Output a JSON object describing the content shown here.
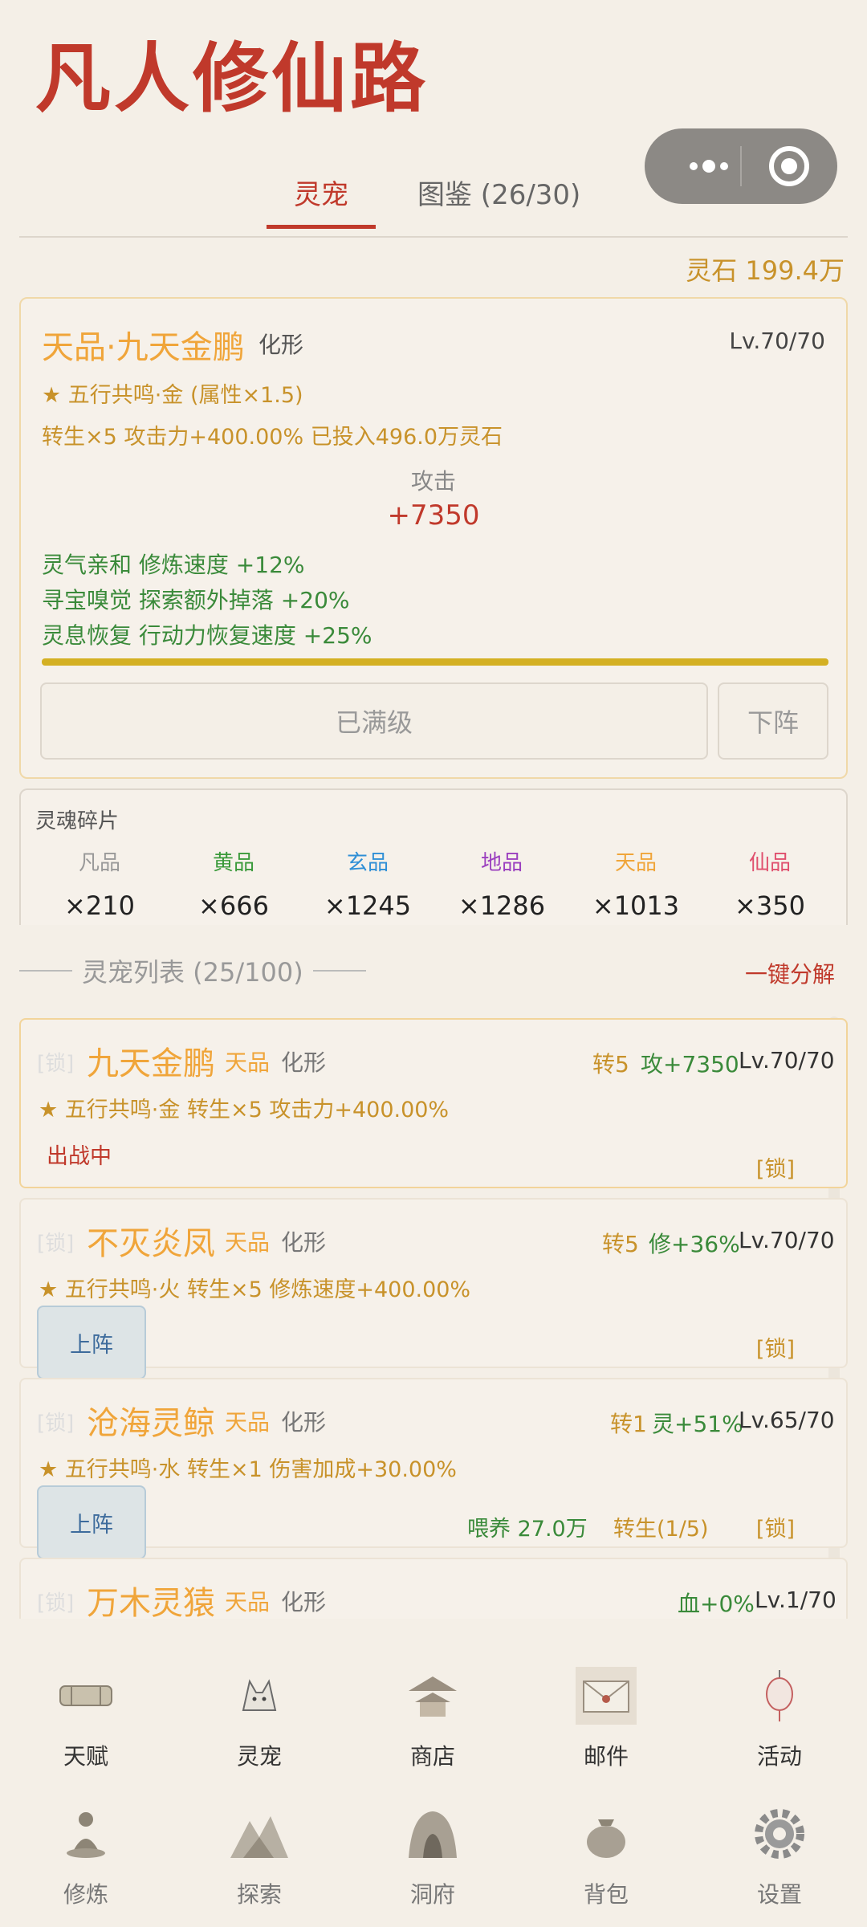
{
  "header": {
    "title": "凡人修仙路"
  },
  "tabs": [
    {
      "label": "灵宠"
    },
    {
      "label": "图鉴 (26/30)"
    }
  ],
  "spirit_stones": "灵石 199.4万",
  "detail": {
    "name": "天品·九天金鹏",
    "form": "化形",
    "level": "Lv.70/70",
    "resonance": "★ 五行共鸣·金 (属性×1.5)",
    "rebirth_info": "转生×5  攻击力+400.00%  已投入496.0万灵石",
    "stat_label": "攻击",
    "stat_value": "+7350",
    "skills": [
      "灵气亲和 修炼速度 +12%",
      "寻宝嗅觉 探索额外掉落 +20%",
      "灵息恢复 行动力恢复速度 +25%"
    ],
    "progress": 1.0,
    "maxed_label": "已满级",
    "remove_label": "下阵"
  },
  "fragments": {
    "title": "灵魂碎片",
    "items": [
      {
        "grade": "凡品",
        "count": "×210",
        "color": "#999999"
      },
      {
        "grade": "黄品",
        "count": "×666",
        "color": "#3a9a3a"
      },
      {
        "grade": "玄品",
        "count": "×1245",
        "color": "#2f8fd6"
      },
      {
        "grade": "地品",
        "count": "×1286",
        "color": "#9b3fbf"
      },
      {
        "grade": "天品",
        "count": "×1013",
        "color": "#f0a53a"
      },
      {
        "grade": "仙品",
        "count": "×350",
        "color": "#e0506e"
      }
    ]
  },
  "list": {
    "title": "灵宠列表 (25/100)",
    "decompose": "一键分解",
    "pets": [
      {
        "lock": "[锁]",
        "name": "九天金鹏",
        "grade": "天品",
        "form": "化形",
        "rebirth": "转5",
        "bonus": "攻+7350",
        "level": "Lv.70/70",
        "line2": "★ 五行共鸣·金  转生×5 攻击力+400.00%",
        "status": "出战中",
        "lock_btn": "[锁]"
      },
      {
        "lock": "[锁]",
        "name": "不灭炎凤",
        "grade": "天品",
        "form": "化形",
        "rebirth": "转5",
        "bonus": "修+36%",
        "level": "Lv.70/70",
        "line2": "★ 五行共鸣·火  转生×5 修炼速度+400.00%",
        "deploy": "上阵",
        "lock_btn": "[锁]"
      },
      {
        "lock": "[锁]",
        "name": "沧海灵鲸",
        "grade": "天品",
        "form": "化形",
        "rebirth": "转1",
        "bonus": "灵+51%",
        "level": "Lv.65/70",
        "line2": "★ 五行共鸣·水  转生×1 伤害加成+30.00%",
        "deploy": "上阵",
        "feed": "喂养 27.0万",
        "rebirth_btn": "转生(1/5)",
        "lock_btn": "[锁]"
      },
      {
        "lock": "[锁]",
        "name": "万木灵猿",
        "grade": "天品",
        "form": "化形",
        "bonus": "血+0%",
        "level": "Lv.1/70"
      }
    ]
  },
  "nav_top": [
    {
      "label": "天赋",
      "icon": "scroll-icon"
    },
    {
      "label": "灵宠",
      "icon": "fox-icon"
    },
    {
      "label": "商店",
      "icon": "pavilion-icon"
    },
    {
      "label": "邮件",
      "icon": "envelope-icon"
    },
    {
      "label": "活动",
      "icon": "lantern-icon"
    }
  ],
  "nav_bottom": [
    {
      "label": "修炼",
      "icon": "meditation-icon"
    },
    {
      "label": "探索",
      "icon": "mountain-icon"
    },
    {
      "label": "洞府",
      "icon": "cave-icon"
    },
    {
      "label": "背包",
      "icon": "bag-icon"
    },
    {
      "label": "设置",
      "icon": "gear-icon"
    }
  ]
}
